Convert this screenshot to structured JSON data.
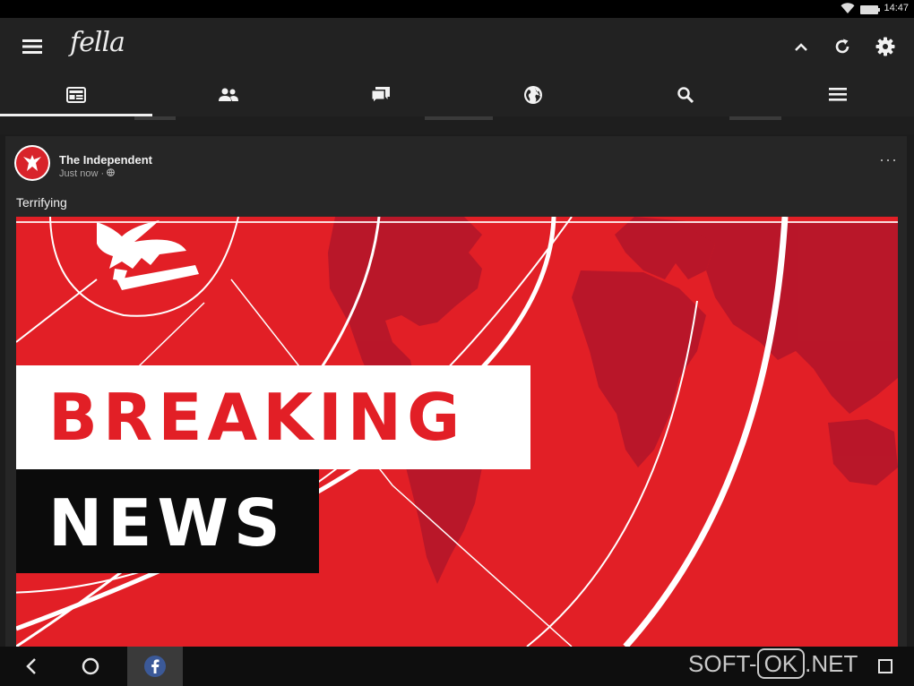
{
  "status_bar": {
    "time": "14:47",
    "icons": [
      "wifi-icon",
      "battery-icon"
    ]
  },
  "app": {
    "name": "fella"
  },
  "toolbar": {
    "icons": [
      "menu-icon",
      "collapse-up-icon",
      "refresh-icon",
      "settings-icon"
    ]
  },
  "tabs": [
    {
      "id": "news-feed",
      "icon": "newspaper-icon",
      "active": true
    },
    {
      "id": "friends",
      "icon": "people-icon",
      "active": false
    },
    {
      "id": "messages",
      "icon": "chat-icon",
      "active": false
    },
    {
      "id": "notifications",
      "icon": "globe-icon",
      "active": false
    },
    {
      "id": "search",
      "icon": "search-icon",
      "active": false
    },
    {
      "id": "more",
      "icon": "menu-icon",
      "active": false
    }
  ],
  "post": {
    "author": "The Independent",
    "time": "Just now · ",
    "privacy_icon": "globe-icon",
    "caption": "Terrifying",
    "more_label": "···",
    "image": {
      "line1": "BREAKING",
      "line2": "NEWS",
      "colors": {
        "red": "#e21f26",
        "dark_red": "#b5162a",
        "black": "#0b0b0b",
        "white": "#ffffff"
      }
    }
  },
  "nav": {
    "icons": [
      "back-icon",
      "home-icon",
      "facebook-app-icon",
      "recents-icon"
    ]
  },
  "watermark": {
    "left": "SOFT-",
    "box": "OK",
    "right": ".NET"
  }
}
